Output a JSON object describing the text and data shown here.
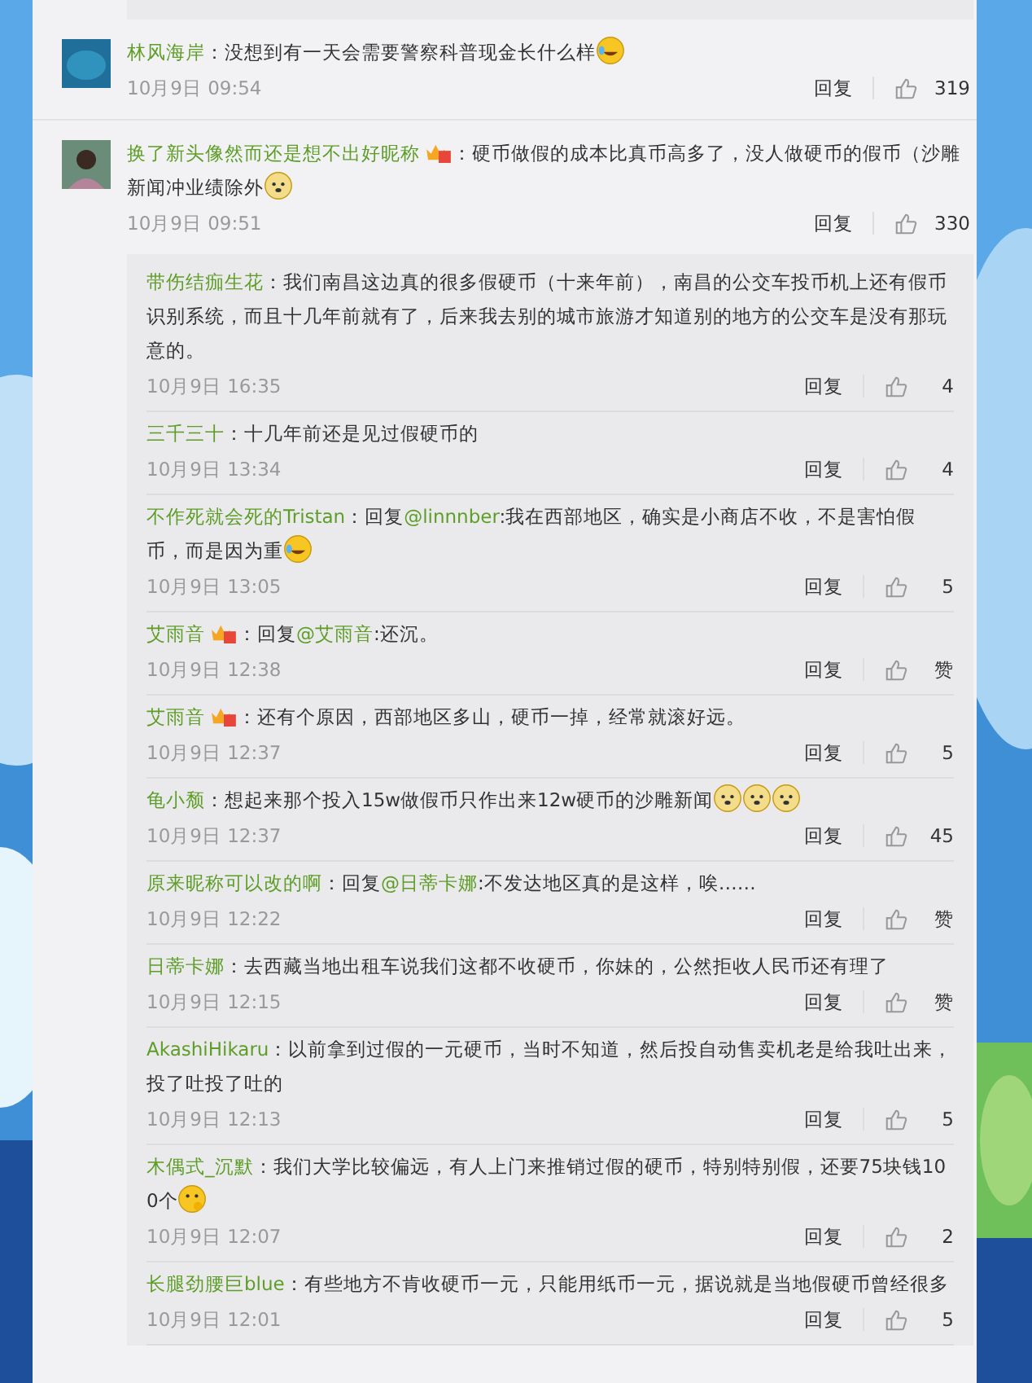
{
  "comments": [
    {
      "user": "林风海岸",
      "badge": false,
      "parts": [
        {
          "kind": "text",
          "text": "：没想到有一天会需要警察科普现金长什么样"
        },
        {
          "kind": "tears"
        }
      ],
      "time": "10月9日 09:54",
      "reply": "回复",
      "likes": "319"
    },
    {
      "user": "换了新头像然而还是想不出好昵称",
      "badge": true,
      "parts": [
        {
          "kind": "text",
          "text": "：硬币做假的成本比真币高多了，没人做硬币的假币（沙雕新闻冲业绩除外"
        },
        {
          "kind": "doge"
        }
      ],
      "time": "10月9日 09:51",
      "reply": "回复",
      "likes": "330",
      "replies": [
        {
          "user": "带伤结痂生花",
          "badge": false,
          "parts": [
            {
              "kind": "text",
              "text": "：我们南昌这边真的很多假硬币（十来年前），南昌的公交车投币机上还有假币识别系统，而且十几年前就有了，后来我去别的城市旅游才知道别的地方的公交车是没有那玩意的。"
            }
          ],
          "time": "10月9日 16:35",
          "reply": "回复",
          "likes": "4"
        },
        {
          "user": "三千三十",
          "badge": false,
          "parts": [
            {
              "kind": "text",
              "text": "：十几年前还是见过假硬币的"
            }
          ],
          "time": "10月9日 13:34",
          "reply": "回复",
          "likes": "4"
        },
        {
          "user": "不作死就会死的Tristan",
          "badge": false,
          "parts": [
            {
              "kind": "text",
              "text": "：回复"
            },
            {
              "kind": "mention",
              "text": "@linnnber"
            },
            {
              "kind": "text",
              "text": ":我在西部地区，确实是小商店不收，不是害怕假币，而是因为重"
            },
            {
              "kind": "tears"
            }
          ],
          "time": "10月9日 13:05",
          "reply": "回复",
          "likes": "5"
        },
        {
          "user": "艾雨音",
          "badge": true,
          "parts": [
            {
              "kind": "text",
              "text": "：回复"
            },
            {
              "kind": "mention",
              "text": "@艾雨音"
            },
            {
              "kind": "text",
              "text": ":还沉。"
            }
          ],
          "time": "10月9日 12:38",
          "reply": "回复",
          "likes": "赞"
        },
        {
          "user": "艾雨音",
          "badge": true,
          "parts": [
            {
              "kind": "text",
              "text": "：还有个原因，西部地区多山，硬币一掉，经常就滚好远。"
            }
          ],
          "time": "10月9日 12:37",
          "reply": "回复",
          "likes": "5"
        },
        {
          "user": "龟小颓",
          "badge": false,
          "parts": [
            {
              "kind": "text",
              "text": "：想起来那个投入15w做假币只作出来12w硬币的沙雕新闻"
            },
            {
              "kind": "doge"
            },
            {
              "kind": "doge"
            },
            {
              "kind": "doge"
            }
          ],
          "time": "10月9日 12:37",
          "reply": "回复",
          "likes": "45"
        },
        {
          "user": "原来昵称可以改的啊",
          "badge": false,
          "parts": [
            {
              "kind": "text",
              "text": "：回复"
            },
            {
              "kind": "mention",
              "text": "@日蒂卡娜"
            },
            {
              "kind": "text",
              "text": ":不发达地区真的是这样，唉……"
            }
          ],
          "time": "10月9日 12:22",
          "reply": "回复",
          "likes": "赞"
        },
        {
          "user": "日蒂卡娜",
          "badge": false,
          "parts": [
            {
              "kind": "text",
              "text": "：去西藏当地出租车说我们这都不收硬币，你妹的，公然拒收人民币还有理了"
            }
          ],
          "time": "10月9日 12:15",
          "reply": "回复",
          "likes": "赞"
        },
        {
          "user": "AkashiHikaru",
          "badge": false,
          "parts": [
            {
              "kind": "text",
              "text": "：以前拿到过假的一元硬币，当时不知道，然后投自动售卖机老是给我吐出来，投了吐投了吐的"
            }
          ],
          "time": "10月9日 12:13",
          "reply": "回复",
          "likes": "5"
        },
        {
          "user": "木偶式_沉默",
          "badge": false,
          "parts": [
            {
              "kind": "text",
              "text": "：我们大学比较偏远，有人上门来推销过假的硬币，特别特别假，还要75块钱100个"
            },
            {
              "kind": "think"
            }
          ],
          "time": "10月9日 12:07",
          "reply": "回复",
          "likes": "2"
        },
        {
          "user": "长腿劲腰巨blue",
          "badge": false,
          "parts": [
            {
              "kind": "text",
              "text": "：有些地方不肯收硬币一元，只能用纸币一元，据说就是当地假硬币曾经很多"
            }
          ],
          "time": "10月9日 12:01",
          "reply": "回复",
          "likes": "5"
        }
      ]
    }
  ]
}
